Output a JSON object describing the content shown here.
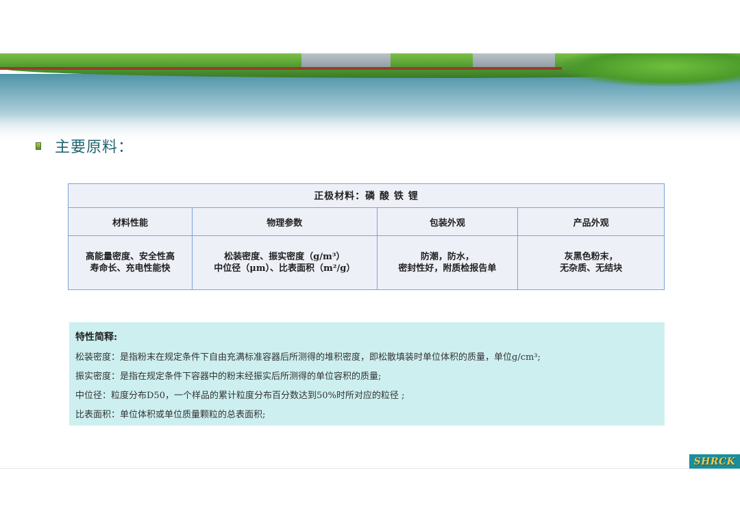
{
  "section": {
    "title": "主要原料："
  },
  "table": {
    "header": "正极材料：磷 酸 铁 锂",
    "columns": [
      "材料性能",
      "物理参数",
      "包装外观",
      "产品外观"
    ],
    "cells": [
      [
        "高能量密度、安全性高",
        "寿命长、充电性能快"
      ],
      [
        "松装密度、振实密度（g/m³）",
        "中位径（μm）、比表面积（m²/g）"
      ],
      [
        "防潮，防水，",
        "密封性好，附质检报告单"
      ],
      [
        "灰黑色粉末，",
        "无杂质、无结块"
      ]
    ]
  },
  "notes": {
    "title": "特性简释:",
    "lines": [
      "松装密度：是指粉末在规定条件下自由充满标准容器后所测得的堆积密度，即松散填装时单位体积的质量，单位g/cm³;",
      "振实密度：是指在规定条件下容器中的粉末经振实后所测得的单位容积的质量;",
      "中位径：粒度分布D50，一个样品的累计粒度分布百分数达到50%时所对应的粒径 ;",
      "比表面积：单位体积或单位质量颗粒的总表面积;"
    ]
  },
  "logo": {
    "text": "SHRCK"
  },
  "colors": {
    "title": "#1f6470",
    "table_border": "#7aa2dc",
    "notes_bg": "#cdeff0",
    "logo_bg": "#1a8f9b"
  }
}
